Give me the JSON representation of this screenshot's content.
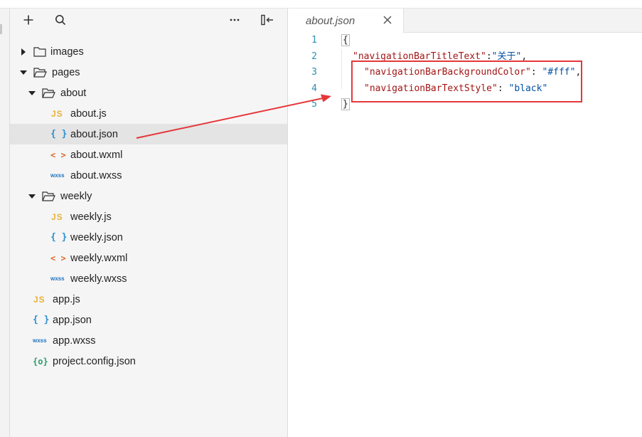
{
  "toolbar": {
    "add_icon": "plus-icon",
    "search_icon": "search-icon",
    "more_icon": "more-horizontal-icon",
    "collapse_icon": "collapse-sidebar-icon"
  },
  "tree": {
    "images": "images",
    "pages": "pages",
    "about": "about",
    "about_js": "about.js",
    "about_json": "about.json",
    "about_wxml": "about.wxml",
    "about_wxss": "about.wxss",
    "weekly": "weekly",
    "weekly_js": "weekly.js",
    "weekly_json": "weekly.json",
    "weekly_wxml": "weekly.wxml",
    "weekly_wxss": "weekly.wxss",
    "app_js": "app.js",
    "app_json": "app.json",
    "app_wxss": "app.wxss",
    "project_config": "project.config.json"
  },
  "icons": {
    "js": "JS",
    "json": "{ }",
    "wxml": "< >",
    "wxss": "wxss",
    "config": "{o}"
  },
  "editor": {
    "tab_title": "about.json",
    "lines": [
      {
        "num": "1",
        "open": "{"
      },
      {
        "num": "2",
        "key": "\"navigationBarTitleText\"",
        "sep": ":",
        "value": "\"关于\"",
        "end": ","
      },
      {
        "num": "3",
        "key": "\"navigationBarBackgroundColor\"",
        "sep": ": ",
        "value": "\"#fff\"",
        "end": ","
      },
      {
        "num": "4",
        "key": "\"navigationBarTextStyle\"",
        "sep": ": ",
        "value": "\"black\"",
        "end": ""
      },
      {
        "num": "5",
        "close": "}"
      }
    ]
  },
  "colors": {
    "annotation": "#e5373a",
    "json_key": "#a31515",
    "json_string": "#0451a5",
    "line_number": "#2b91af",
    "selected_row": "#e4e4e4"
  }
}
